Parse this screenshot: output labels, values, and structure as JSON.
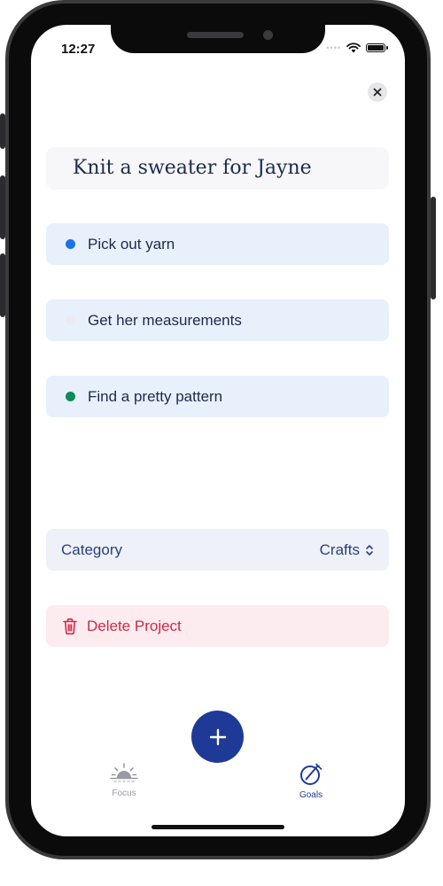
{
  "status_bar": {
    "time": "12:27",
    "signal_icon": "signal-dots-icon",
    "wifi_icon": "wifi-icon",
    "battery_icon": "battery-icon"
  },
  "header": {
    "close_icon": "close-icon"
  },
  "project": {
    "title": "Knit a sweater for Jayne"
  },
  "tasks": [
    {
      "label": "Pick out yarn",
      "dot_color": "#1a73e8"
    },
    {
      "label": "Get her measurements",
      "dot_color": "#ececf0"
    },
    {
      "label": "Find a pretty pattern",
      "dot_color": "#0f8a5c"
    }
  ],
  "category": {
    "label": "Category",
    "value": "Crafts",
    "icon": "chevron-up-down-icon"
  },
  "delete": {
    "label": "Delete Project",
    "icon": "trash-icon"
  },
  "fab": {
    "icon": "plus-icon"
  },
  "tab_bar": {
    "focus_label": "Focus",
    "focus_icon": "sunrise-icon",
    "goals_label": "Goals",
    "goals_icon": "target-pencil-icon"
  },
  "colors": {
    "accent": "#1f3a96",
    "text_dark": "#1c2a4d",
    "task_bg": "#e8f0fb",
    "delete_red": "#cf2a48",
    "delete_bg": "#fdecef"
  }
}
